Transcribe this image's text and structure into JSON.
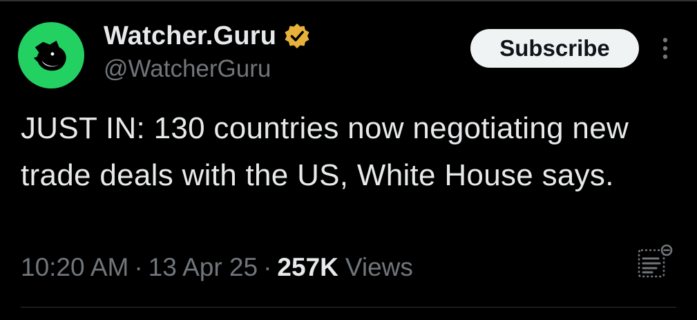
{
  "tweet": {
    "author": {
      "display_name": "Watcher.Guru",
      "handle": "@WatcherGuru",
      "verified": true,
      "avatar_icon": "whale-icon",
      "avatar_color": "#23d163",
      "badge_color": "#e8b23a"
    },
    "subscribe_label": "Subscribe",
    "text": "JUST IN: 130 countries now negotiating new trade deals with the US, White House says.",
    "time": "10:20 AM",
    "date": "13 Apr 25",
    "separator": "·",
    "views_count": "257K",
    "views_label": "Views"
  },
  "colors": {
    "background": "#000000",
    "text_primary": "#e7e9ea",
    "text_secondary": "#71767b",
    "divider": "#2f3336"
  }
}
